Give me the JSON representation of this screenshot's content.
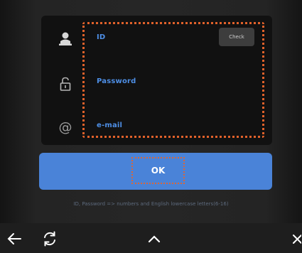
{
  "form": {
    "id_label": "ID",
    "check_label": "Check",
    "password_label": "Password",
    "email_label": "e-mail"
  },
  "icons": {
    "user": "user-icon",
    "lock": "lock-icon",
    "email": "at-icon",
    "email_glyph": "@"
  },
  "ok_label": "OK",
  "hint": "ID, Password => numbers and English lowercase letters(6-16)",
  "nav": [
    "back-arrow-icon",
    "refresh-icon",
    "chevron-up-icon",
    "close-icon"
  ],
  "colors": {
    "accent": "#4a83d8",
    "label": "#4e8fe6",
    "highlight": "#e0612a"
  }
}
